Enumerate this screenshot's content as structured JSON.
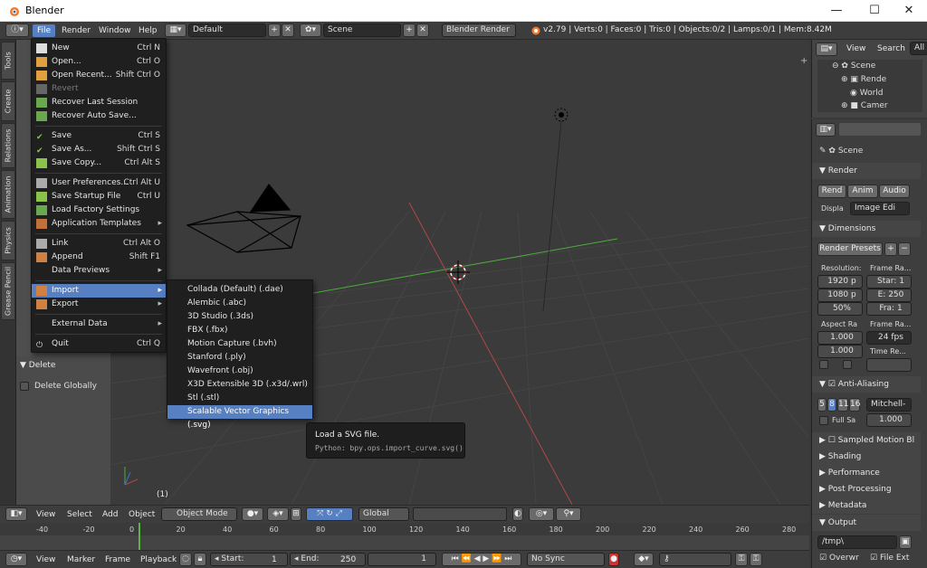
{
  "window": {
    "title": "Blender",
    "min": "—",
    "max": "☐",
    "close": "✕"
  },
  "info_header": {
    "menus": [
      "File",
      "Render",
      "Window",
      "Help"
    ],
    "layout": "Default",
    "scene": "Scene",
    "engine": "Blender Render",
    "stats": "v2.79 | Verts:0 | Faces:0 | Tris:0 | Objects:0/2 | Lamps:0/1 | Mem:8.42M"
  },
  "file_menu": {
    "items": [
      {
        "label": "New",
        "key": "Ctrl N"
      },
      {
        "label": "Open...",
        "key": "Ctrl O"
      },
      {
        "label": "Open Recent...",
        "key": "Shift Ctrl O"
      },
      {
        "label": "Revert",
        "key": ""
      },
      {
        "label": "Recover Last Session",
        "key": ""
      },
      {
        "label": "Recover Auto Save...",
        "key": ""
      },
      {
        "label": "Save",
        "key": "Ctrl S"
      },
      {
        "label": "Save As...",
        "key": "Shift Ctrl S"
      },
      {
        "label": "Save Copy...",
        "key": "Ctrl Alt S"
      },
      {
        "label": "User Preferences...",
        "key": "Ctrl Alt U"
      },
      {
        "label": "Save Startup File",
        "key": "Ctrl U"
      },
      {
        "label": "Load Factory Settings",
        "key": ""
      },
      {
        "label": "Application Templates",
        "key": ""
      },
      {
        "label": "Link",
        "key": "Ctrl Alt O"
      },
      {
        "label": "Append",
        "key": "Shift F1"
      },
      {
        "label": "Data Previews",
        "key": ""
      },
      {
        "label": "Import",
        "key": ""
      },
      {
        "label": "Export",
        "key": ""
      },
      {
        "label": "External Data",
        "key": ""
      },
      {
        "label": "Quit",
        "key": "Ctrl Q"
      }
    ]
  },
  "import_submenu": {
    "items": [
      "Collada (Default) (.dae)",
      "Alembic (.abc)",
      "3D Studio (.3ds)",
      "FBX (.fbx)",
      "Motion Capture (.bvh)",
      "Stanford (.ply)",
      "Wavefront (.obj)",
      "X3D Extensible 3D (.x3d/.wrl)",
      "Stl (.stl)",
      "Scalable Vector Graphics (.svg)"
    ]
  },
  "tooltip": {
    "title": "Load a SVG file.",
    "python": "Python: bpy.ops.import_curve.svg()"
  },
  "tool_tabs": [
    "Tools",
    "Create",
    "Relations",
    "Animation",
    "Physics",
    "Grease Pencil"
  ],
  "toolshelf": {
    "delete_header": "Delete",
    "delete_globally": "Delete Globally"
  },
  "viewport": {
    "frame_counter": "(1)"
  },
  "outliner": {
    "view": "View",
    "search": "Search",
    "all": "All",
    "tree": [
      "Scene",
      "Rende",
      "World",
      "Camer"
    ]
  },
  "properties": {
    "scene": "Scene",
    "render_header": "Render",
    "render_btns": [
      "Rend",
      "Anim",
      "Audio"
    ],
    "display_label": "Displa",
    "display_value": "Image Edi",
    "dimensions_header": "Dimensions",
    "render_presets": "Render Presets",
    "resolution_label": "Resolution:",
    "frame_range_label": "Frame Ra...",
    "res_x": "1920 p",
    "res_y": "1080 p",
    "res_pct": "50%",
    "start": "Star: 1",
    "end": "E: 250",
    "frame": "Fra: 1",
    "aspect_label": "Aspect Ra",
    "frame_rate_label": "Frame Ra...",
    "aspect_x": "1.000",
    "aspect_y": "1.000",
    "fps": "24 fps",
    "time_remap": "Time Re...",
    "aa_header": "Anti-Aliasing",
    "aa_samples": [
      "5",
      "8",
      "11",
      "16"
    ],
    "aa_filter": "Mitchell-",
    "full_sample": "Full Sa",
    "filter_size": "1.000",
    "collapsed_panels": [
      "Sampled Motion Bl",
      "Shading",
      "Performance",
      "Post Processing",
      "Metadata"
    ],
    "output_header": "Output",
    "output_path": "/tmp\\",
    "overwrite": "Overwr",
    "file_ext": "File Ext"
  },
  "view_header": {
    "menus": [
      "View",
      "Select",
      "Add",
      "Object"
    ],
    "mode": "Object Mode",
    "orientation": "Global"
  },
  "timeline": {
    "ticks": [
      "-40",
      "-20",
      "0",
      "20",
      "40",
      "60",
      "80",
      "100",
      "120",
      "140",
      "160",
      "180",
      "200",
      "220",
      "240",
      "260",
      "280"
    ]
  },
  "timeline_header": {
    "menus": [
      "View",
      "Marker",
      "Frame",
      "Playback"
    ],
    "start": "Start:",
    "start_val": "1",
    "end": "End:",
    "end_val": "250",
    "current": "1",
    "sync": "No Sync"
  },
  "colors": {
    "accent": "#5680c2",
    "x_axis": "#b04848",
    "y_axis": "#4cae3c"
  }
}
